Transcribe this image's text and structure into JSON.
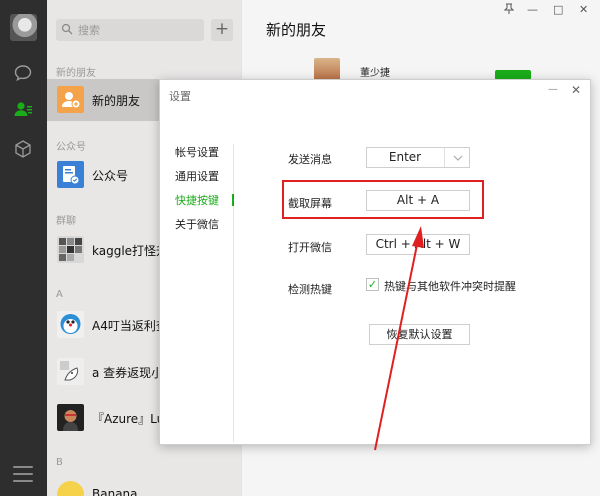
{
  "search": {
    "placeholder": "搜索",
    "add_label": "+"
  },
  "list": {
    "sections": [
      "新的朋友",
      "公众号",
      "群聊",
      "A",
      "B"
    ],
    "items": [
      {
        "name": "新的朋友",
        "color": "#f5a34b"
      },
      {
        "name": "公众号",
        "color": "#3a80d6"
      },
      {
        "name": "kaggle打怪升",
        "color": "#666"
      },
      {
        "name": "A4叮当返利查",
        "color": "#f0f0f0"
      },
      {
        "name": "a 查券返现小",
        "color": "#eee"
      },
      {
        "name": "『Azure』Luc",
        "color": "#222"
      },
      {
        "name": "Banana",
        "color": "#f5d24a"
      }
    ]
  },
  "main": {
    "title": "新的朋友",
    "pin_icon": "pin-icon",
    "friend_name": "董少捷",
    "win_controls": [
      "—",
      "□",
      "✕"
    ]
  },
  "dialog": {
    "title": "设置",
    "min": "—",
    "close": "✕",
    "menu": [
      "帐号设置",
      "通用设置",
      "快捷按键",
      "关于微信"
    ],
    "active_menu": "快捷按键",
    "rows": {
      "send": {
        "label": "发送消息",
        "value": "Enter"
      },
      "capture": {
        "label": "截取屏幕",
        "value": "Alt + A"
      },
      "open": {
        "label": "打开微信",
        "value": "Ctrl + Alt + W"
      },
      "detect": {
        "label": "检测热键",
        "check_text": "热键与其他软件冲突时提醒",
        "checked": true
      }
    },
    "restore_label": "恢复默认设置"
  },
  "colors": {
    "accent": "#1aad19",
    "highlight": "#e02020",
    "nav_bg": "#2e2e2e"
  }
}
